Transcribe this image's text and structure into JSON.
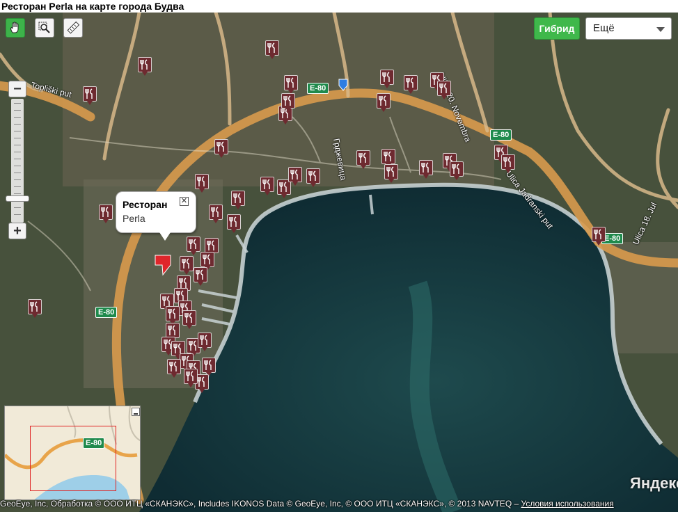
{
  "page": {
    "title": "Ресторан Perla на карте города Будва"
  },
  "toolbar": {
    "tools": [
      {
        "name": "hand-tool",
        "icon": "hand-icon",
        "active": true
      },
      {
        "name": "magnifier-tool",
        "icon": "magnifier-icon",
        "active": false
      },
      {
        "name": "ruler-tool",
        "icon": "ruler-icon",
        "active": false
      }
    ],
    "hybrid_label": "Гибрид",
    "more_label": "Ещё"
  },
  "zoom": {
    "plus": "+",
    "minus": "−",
    "level_fraction": 0.84
  },
  "balloon": {
    "title": "Ресторан",
    "subtitle": "Perla",
    "close_icon": "close-icon"
  },
  "labels": {
    "roads": [
      "E-80",
      "E-80",
      "E-80",
      "E-80"
    ],
    "streets": [
      "Topliški put",
      "Ulica 20. Novembra",
      "Ulica Jadranski put",
      "Ulica 18. Jul",
      "Грджевица"
    ]
  },
  "minimap": {
    "road": "E-80"
  },
  "copyright": {
    "text": "GeoEye, Inc, Обработка © ООО ИТЦ «СКАНЭКС», Includes IKONOS Data © GeoEye, Inc, © ООО ИТЦ «СКАНЭКС», © 2013 NAVTEQ –",
    "terms_link": "Условия использования"
  },
  "brand": {
    "logo_text": "Яндекс"
  },
  "colors": {
    "sea": "#163a40",
    "land": "#3e4f3a",
    "road": "#d89a4c",
    "marker": "#6e2a30",
    "hybrid_button": "#3fb84b"
  }
}
